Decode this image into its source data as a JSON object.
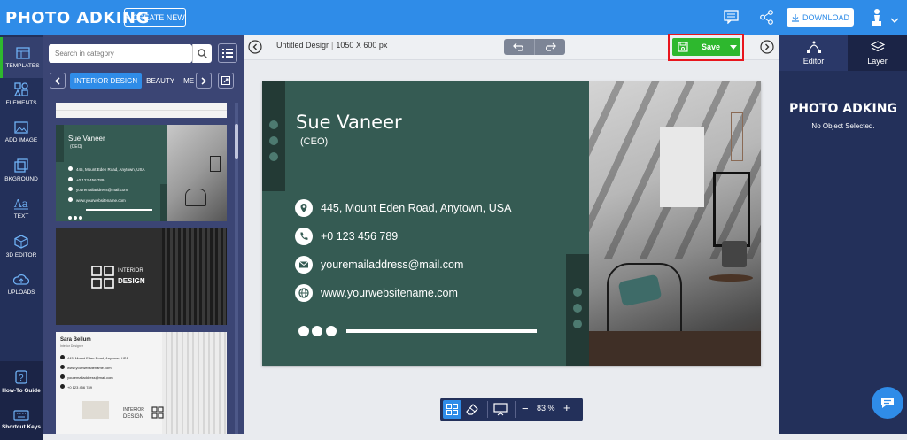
{
  "app": {
    "logo": "PHOTO ADKING",
    "create_label": "CREATE NEW",
    "download_label": "DOWNLOAD"
  },
  "leftnav": [
    {
      "label": "TEMPLATES",
      "icon": "templates-icon"
    },
    {
      "label": "ELEMENTS",
      "icon": "elements-icon"
    },
    {
      "label": "ADD IMAGE",
      "icon": "add-image-icon"
    },
    {
      "label": "BKGROUND",
      "icon": "background-icon"
    },
    {
      "label": "TEXT",
      "icon": "text-icon"
    },
    {
      "label": "3D EDITOR",
      "icon": "3d-editor-icon"
    },
    {
      "label": "UPLOADS",
      "icon": "uploads-icon"
    },
    {
      "label": "How-To Guide",
      "icon": "guide-icon"
    },
    {
      "label": "Shortcut Keys",
      "icon": "keyboard-icon"
    }
  ],
  "panel": {
    "search_placeholder": "Search in category",
    "categories": [
      "INTERIOR DESIGN",
      "BEAUTY",
      "MEDI"
    ],
    "thumb1": {
      "name": "Sue Vaneer",
      "role": "(CEO)",
      "address": "445, Mount Eden Road, Anytown, USA",
      "phone": "+0 123 456 789",
      "email": "youremailaddress@mail.com",
      "web": "www.yourwebsitename.com"
    },
    "thumb2": {
      "line1": "INTERIOR",
      "line2": "DESIGN"
    },
    "thumb3": {
      "name": "Sara Bellum",
      "sub": "Interior Designer",
      "address": "445, Mount Eden Road, Anytown, USA",
      "web": "www.yourwebsitename.com",
      "email": "youremailaddress@mail.com",
      "phone": "+0 123 456 789",
      "line1": "INTERIOR",
      "line2": "DESIGN"
    }
  },
  "toolbar": {
    "doc_title": "Untitled Desigr",
    "doc_size": "1050 X 600 px",
    "save_label": "Save"
  },
  "card": {
    "name": "Sue Vaneer",
    "role": "(CEO)",
    "address": "445, Mount Eden Road, Anytown, USA",
    "phone": "+0 123 456 789",
    "email": "youremailaddress@mail.com",
    "web": "www.yourwebsitename.com"
  },
  "bottom": {
    "zoom": "83 %",
    "minus": "−",
    "plus": "+"
  },
  "right": {
    "tab_editor": "Editor",
    "tab_layer": "Layer",
    "logo": "PHOTO ADKING",
    "no_object": "No Object Selected."
  },
  "colors": {
    "brand": "#2f8ce8",
    "nav": "#23305a",
    "card_green": "#355b53",
    "save": "#2eb82e",
    "highlight": "#e8151d"
  }
}
